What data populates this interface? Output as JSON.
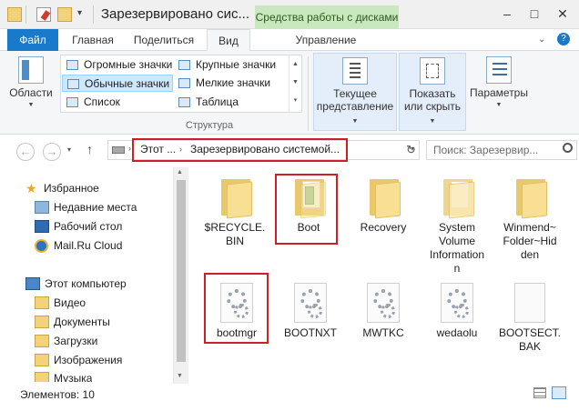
{
  "window": {
    "title": "Зарезервировано сис...",
    "context_tab": "Средства работы с дисками",
    "minimize": "–",
    "maximize": "□",
    "close": "✕"
  },
  "ribbon_tabs": {
    "file": "Файл",
    "home": "Главная",
    "share": "Поделиться",
    "view": "Вид",
    "manage": "Управление"
  },
  "ribbon": {
    "panes": "Области",
    "layouts": [
      "Огромные значки",
      "Крупные значки",
      "Обычные значки",
      "Мелкие значки",
      "Список",
      "Таблица"
    ],
    "group_label": "Структура",
    "current_view": [
      "Текущее",
      "представление"
    ],
    "show_hide": [
      "Показать",
      "или скрыть"
    ],
    "options": "Параметры"
  },
  "address": {
    "crumbs": [
      "Этот ...",
      "Зарезервировано системой..."
    ],
    "search_placeholder": "Поиск: Зарезервир..."
  },
  "nav": {
    "favorites": "Избранное",
    "recent": "Недавние места",
    "desktop": "Рабочий стол",
    "mailru": "Mail.Ru Cloud",
    "this_pc": "Этот компьютер",
    "videos": "Видео",
    "documents": "Документы",
    "downloads": "Загрузки",
    "pictures": "Изображения",
    "music": "Музыка"
  },
  "files": [
    {
      "name": "$RECYCLE.BIN",
      "type": "folder"
    },
    {
      "name": "Boot",
      "type": "folder"
    },
    {
      "name": "Recovery",
      "type": "folder"
    },
    {
      "name": "System Volume Information",
      "type": "folder"
    },
    {
      "name": "Winmend~Folder~Hidden",
      "type": "folder"
    },
    {
      "name": "bootmgr",
      "type": "system-file"
    },
    {
      "name": "BOOTNXT",
      "type": "system-file"
    },
    {
      "name": "MWTKC",
      "type": "system-file"
    },
    {
      "name": "wedaolu",
      "type": "system-file"
    },
    {
      "name": "BOOTSECT.BAK",
      "type": "file"
    }
  ],
  "file_labels": {
    "recycle": [
      "$RECYCLE.",
      "BIN"
    ],
    "boot": "Boot",
    "recovery": "Recovery",
    "svi": [
      "System",
      "Volume",
      "Information"
    ],
    "winmend": [
      "Winmend~",
      "Folder~Hid",
      "den"
    ],
    "bootmgr": "bootmgr",
    "bootnxt": "BOOTNXT",
    "mwtkc": "MWTKC",
    "wedaolu": "wedaolu",
    "bootsect": [
      "BOOTSECT.",
      "BAK"
    ]
  },
  "status": {
    "items": "Элементов: 10"
  },
  "colors": {
    "file_tab": "#1979ca",
    "context_tab": "#c9e8bf",
    "highlight_red": "#cc2027"
  }
}
